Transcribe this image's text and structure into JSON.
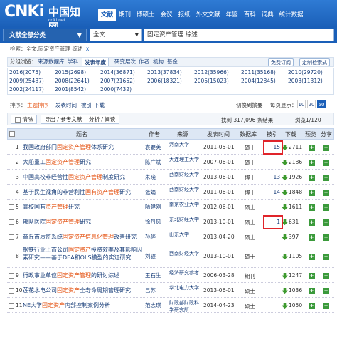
{
  "logo": {
    "word": "CNKi",
    "cn": "中国知网",
    "sub": "cnki.net"
  },
  "nav": [
    "文献",
    "期刊",
    "博硕士",
    "会议",
    "报纸",
    "外文文献",
    "年鉴",
    "百科",
    "词典",
    "统计数据"
  ],
  "search": {
    "category": "文献全部分类",
    "scope": "全文",
    "keyword": "固定资产管理 综述"
  },
  "breadcrumb": {
    "text": "检索：全文:固定资产管理 综述",
    "close": "x"
  },
  "group": {
    "label": "分组浏览：",
    "tabs": [
      "来源数据库",
      "学科",
      "发表年度",
      "研究层次",
      "作者",
      "机构",
      "基金"
    ],
    "free_btn": "免费订阅",
    "custom_btn": "定制检索式"
  },
  "years": [
    "2016(2075)",
    "2015(2698)",
    "2014(36871)",
    "2013(37834)",
    "2012(35966)",
    "2011(35168)",
    "2010(29720)",
    "2009(25487)",
    "2008(22641)",
    "2007(21652)",
    "2006(18321)",
    "2005(15023)",
    "2004(12845)",
    "2003(11312)",
    "2002(24117)",
    "2001(8542)",
    "2000(7432)"
  ],
  "sort": {
    "label": "排序：",
    "items": [
      "主题排序",
      "发表时间",
      "被引",
      "下载"
    ],
    "switch": "切换到摘要",
    "per_page_label": "每页显示：",
    "per_page": [
      "10",
      "20",
      "50"
    ]
  },
  "toolbar": {
    "clear": "清除",
    "export": "导出 / 参考文献",
    "analyze": "分析 / 阅读",
    "found": "找到 317,096 条结果",
    "pages": "浏览1/120"
  },
  "table": {
    "headers": [
      "题名",
      "作者",
      "来源",
      "发表时间",
      "数据库",
      "被引",
      "下载",
      "预览",
      "分享"
    ]
  },
  "rows": [
    {
      "num": "1",
      "title": [
        "我国政府部门",
        "固定资产管理",
        "体系研究"
      ],
      "author": "袁要英",
      "source": "河南大学",
      "date": "2011-05-01",
      "db": "硕士",
      "cite": "15",
      "dl": "2711"
    },
    {
      "num": "2",
      "title": [
        "大船重工",
        "固定资产管理",
        "研究"
      ],
      "author": "陈广斌",
      "source": "大连理工大学",
      "date": "2007-06-01",
      "db": "硕士",
      "cite": "",
      "dl": "2186"
    },
    {
      "num": "3",
      "title": [
        "中国高校非经营性",
        "固定资产管理",
        "制度研究"
      ],
      "author": "朱晓",
      "source": "西南财经大学",
      "date": "2013-06-01",
      "db": "博士",
      "cite": "13",
      "dl": "1926"
    },
    {
      "num": "4",
      "title": [
        "基于民生视角的非营利性",
        "国有资产管理",
        "研究"
      ],
      "author": "张娟",
      "source": "西南财经大学",
      "date": "2011-06-01",
      "db": "博士",
      "cite": "14",
      "dl": "1848"
    },
    {
      "num": "5",
      "title": [
        "高校国有",
        "资产管理",
        "研究"
      ],
      "author": "陆建刚",
      "source": "南京农业大学",
      "date": "2012-06-01",
      "db": "硕士",
      "cite": "",
      "dl": "1611"
    },
    {
      "num": "6",
      "title": [
        "部队医院",
        "固定资产管理",
        "研究"
      ],
      "author": "徐丹风",
      "source": "东北财经大学",
      "date": "2013-10-01",
      "db": "硕士",
      "cite": "1",
      "dl": "631"
    },
    {
      "num": "7",
      "title": [
        "商丘市质监系统",
        "固定资产信息化管理",
        "改善研究"
      ],
      "author": "孙骅",
      "source": "山东大学",
      "date": "2013-04-20",
      "db": "硕士",
      "cite": "",
      "dl": "397"
    },
    {
      "num": "8",
      "title": [
        "钢铁行业上市公司",
        "固定资产",
        "投资效率及其影响因素研究——基于DEA和OLS模型的实证研究"
      ],
      "author": "刘骏",
      "source": "西南财经大学",
      "date": "2013-10-01",
      "db": "硕士",
      "cite": "",
      "dl": "1105"
    },
    {
      "num": "9",
      "title": [
        "行政事业单位",
        "固定资产管理",
        "的研讨综述"
      ],
      "author": "王石生",
      "source": "经济研究参考",
      "date": "2006-03-28",
      "db": "期刊",
      "cite": "",
      "dl": "1247"
    },
    {
      "num": "10",
      "title": [
        "莲花水电公司",
        "固定资产",
        "全寿命周期管理研究"
      ],
      "author": "吕苏",
      "source": "华北电力大学",
      "date": "2013-06-01",
      "db": "硕士",
      "cite": "",
      "dl": "1036"
    },
    {
      "num": "11",
      "title": [
        "NE大学",
        "固定资产",
        "内部控制案例分析"
      ],
      "author": "范志琪",
      "source": "财政部财政科学研究所",
      "date": "2014-04-23",
      "db": "硕士",
      "cite": "",
      "dl": "1050"
    }
  ],
  "colors": {
    "brand": "#1a5fb8",
    "highlight": "#e4500f",
    "link": "#1a3f7a",
    "annotation": "#e0242a"
  }
}
